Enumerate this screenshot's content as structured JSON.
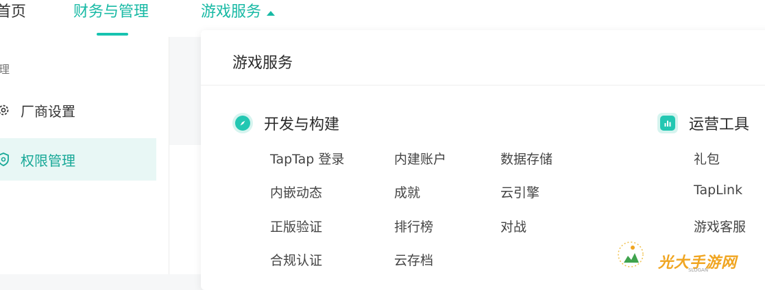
{
  "nav": {
    "home": "首页",
    "finance": "财务与管理",
    "games": "游戏服务"
  },
  "sidebar": {
    "group_label": "理",
    "items": [
      {
        "label": "厂商设置",
        "icon": "gear-icon"
      },
      {
        "label": "权限管理",
        "icon": "shield-icon"
      }
    ]
  },
  "dropdown": {
    "title": "游戏服务",
    "sections": [
      {
        "title": "开发与构建",
        "icon": "compass-icon",
        "columns": [
          [
            "TapTap 登录",
            "内嵌动态",
            "正版验证",
            "合规认证"
          ],
          [
            "内建账户",
            "成就",
            "排行榜",
            "云存档"
          ],
          [
            "数据存储",
            "云引擎",
            "对战"
          ]
        ]
      },
      {
        "title": "运营工具",
        "icon": "bar-chart-icon",
        "items": [
          "礼包",
          "TapLink",
          "游戏客服"
        ]
      }
    ]
  },
  "watermark": {
    "text": "光大手游网",
    "sub": "SLOGAN"
  },
  "colors": {
    "accent": "#17b9a4",
    "accent_light": "#e8f7f5",
    "icon_bg": "#23c7b2"
  }
}
